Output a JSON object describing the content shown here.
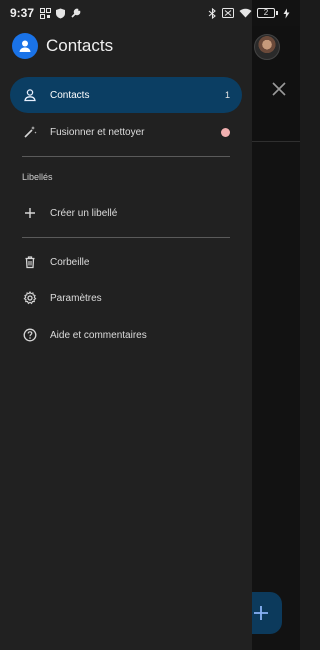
{
  "status_bar": {
    "time": "9:37",
    "battery": "2"
  },
  "drawer": {
    "app_title": "Contacts",
    "items": [
      {
        "label": "Contacts",
        "count": "1",
        "icon": "person-icon",
        "active": true
      },
      {
        "label": "Fusionner et nettoyer",
        "icon": "magic-wand-icon",
        "badge": "dot"
      }
    ],
    "labels_section": "Libellés",
    "create_label": "Créer un libellé",
    "bottom_items": [
      {
        "label": "Corbeille",
        "icon": "trash-icon"
      },
      {
        "label": "Paramètres",
        "icon": "gear-icon"
      },
      {
        "label": "Aide et commentaires",
        "icon": "help-icon"
      }
    ]
  },
  "colors": {
    "accent": "#1a73e8",
    "active_bg": "#0b3e63",
    "drawer_bg": "#212121",
    "badge": "#f1b0b0"
  }
}
